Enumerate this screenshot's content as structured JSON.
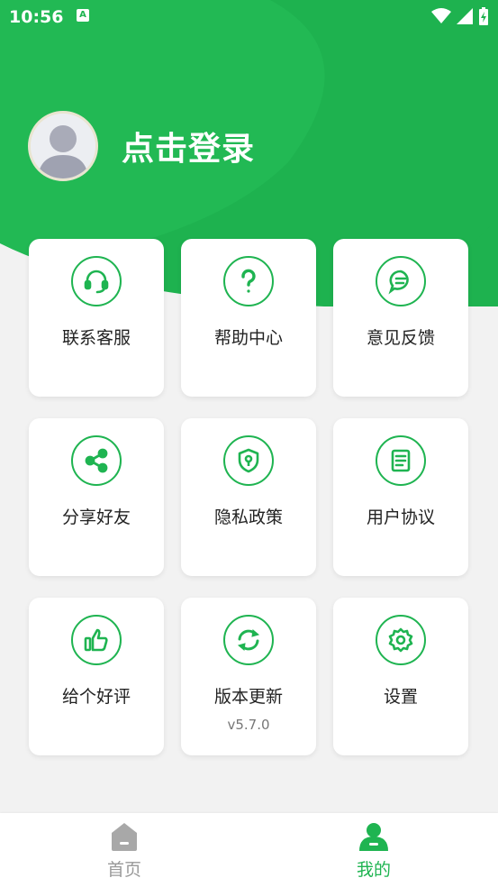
{
  "colors": {
    "accent": "#1fb451",
    "accent_light": "#2cc35e",
    "tab_inactive": "#999999"
  },
  "status_bar": {
    "time": "10:56",
    "notification_badge": "A"
  },
  "profile": {
    "login_label": "点击登录"
  },
  "menu": [
    {
      "label": "联系客服",
      "icon": "headset-icon"
    },
    {
      "label": "帮助中心",
      "icon": "question-icon"
    },
    {
      "label": "意见反馈",
      "icon": "chat-icon"
    },
    {
      "label": "分享好友",
      "icon": "share-icon"
    },
    {
      "label": "隐私政策",
      "icon": "shield-icon"
    },
    {
      "label": "用户协议",
      "icon": "document-icon"
    },
    {
      "label": "给个好评",
      "icon": "thumbs-up-icon"
    },
    {
      "label": "版本更新",
      "icon": "refresh-icon",
      "sub": "v5.7.0"
    },
    {
      "label": "设置",
      "icon": "gear-icon"
    }
  ],
  "tabbar": {
    "home_label": "首页",
    "mine_label": "我的",
    "active": "mine"
  }
}
